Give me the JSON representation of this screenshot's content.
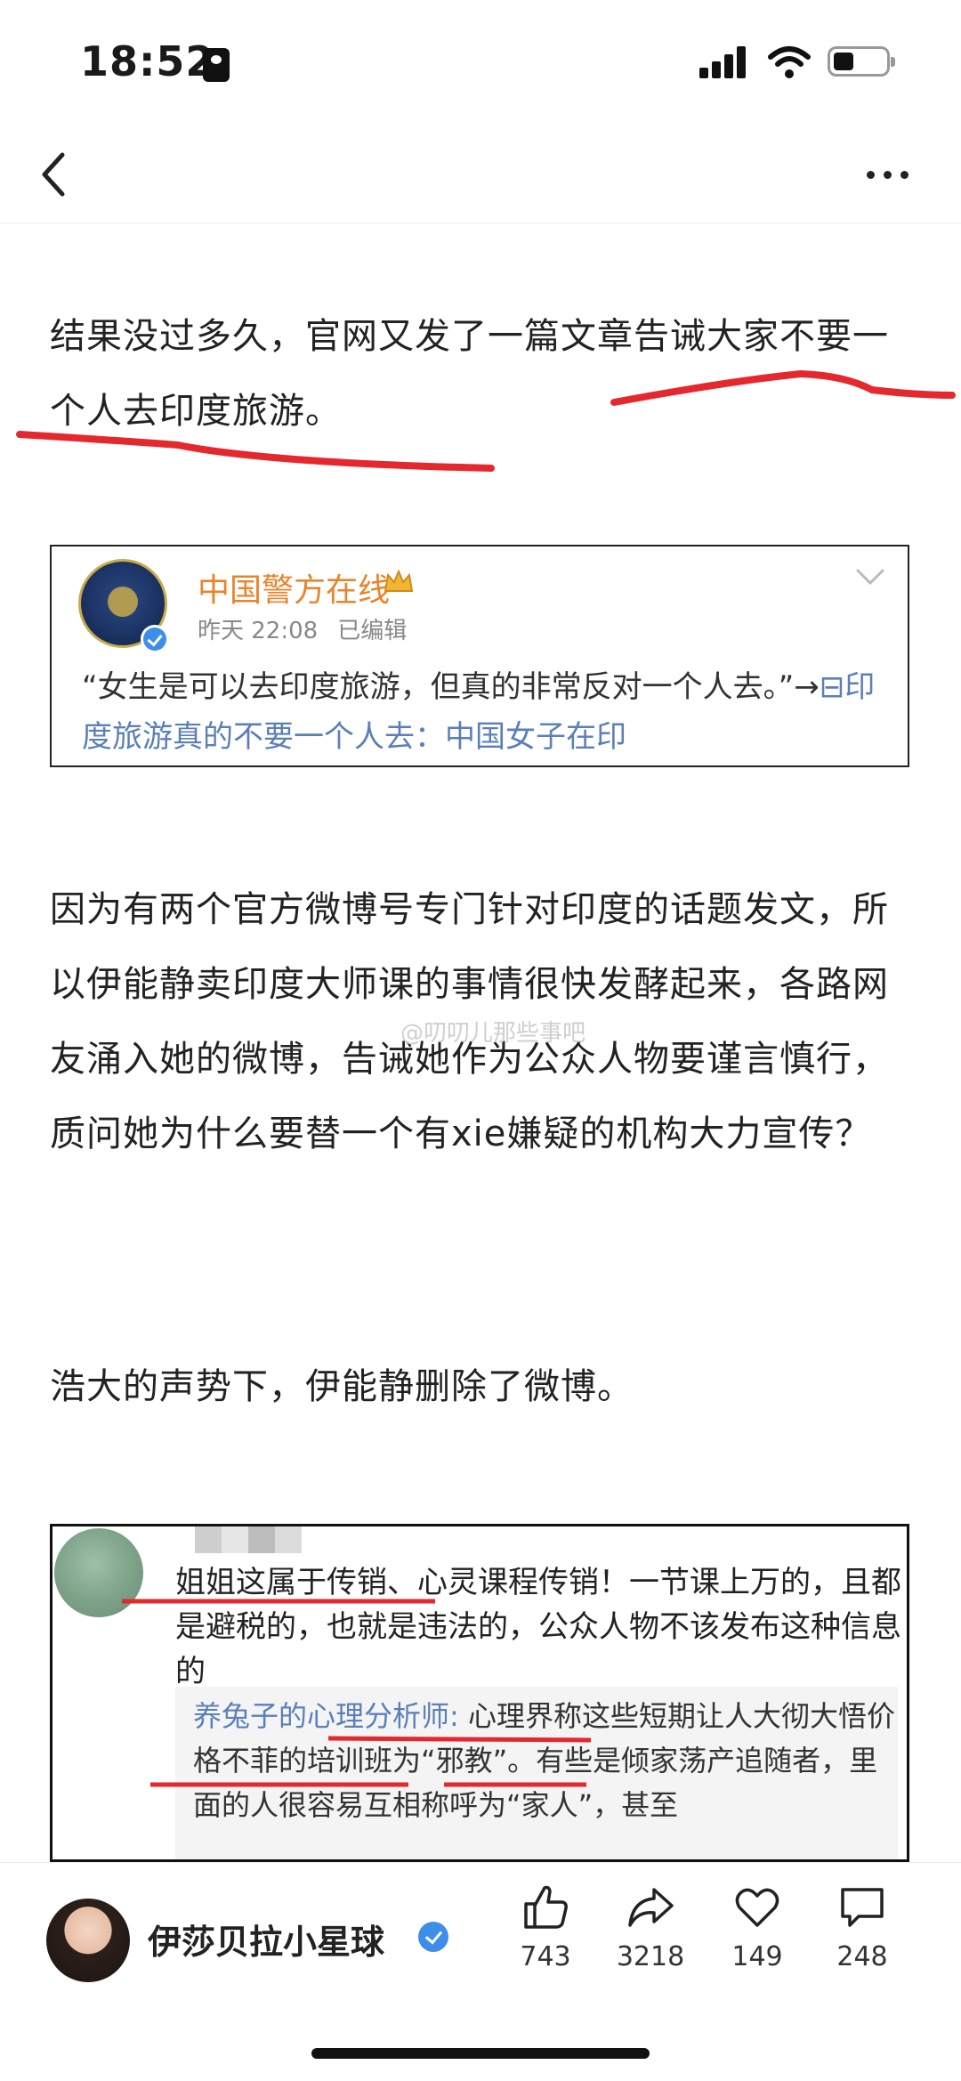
{
  "status_bar": {
    "time": "18:52"
  },
  "article": {
    "paragraph1": "结果没过多久，官网又发了一篇文章告诫大家不要一个人去印度旅游。",
    "paragraph2": "因为有两个官方微博号专门针对印度的话题发文，所以伊能静卖印度大师课的事情很快发酵起来，各路网友涌入她的微博，告诫她作为公众人物要谨言慎行，质问她为什么要替一个有xie嫌疑的机构大力宣传？",
    "paragraph3": "浩大的声势下，伊能静删除了微博。",
    "watermark": "@叨叨儿那些事吧"
  },
  "embedded_post": {
    "account_name": "中国警方在线",
    "time": "昨天 22:08",
    "edited": "已编辑",
    "quote": "“女生是可以去印度旅游，但真的非常反对一个人去。”→",
    "link_text": "印度旅游真的不要一个人去：中国女子在印"
  },
  "embedded_comment": {
    "text": "姐姐这属于传销、心灵课程传销！一节课上万的，且都是避税的，也就是违法的，公众人物不该发布这种信息的",
    "reply_name": "养兔子的心理分析师:",
    "reply_text": " 心理界称这些短期让人大彻大悟价格不菲的培训班为“邪教”。有些是倾家荡产追随者，里面的人很容易互相称呼为“家人”，甚至"
  },
  "bottom_bar": {
    "author_name": "伊莎贝拉小星球",
    "likes": "743",
    "reposts": "3218",
    "favorites": "149",
    "comments": "248"
  },
  "colors": {
    "accent_orange": "#e8852b",
    "link_blue": "#5b7fb8",
    "verify_blue": "#3d8ee8",
    "annotation_red": "#e5282e"
  }
}
